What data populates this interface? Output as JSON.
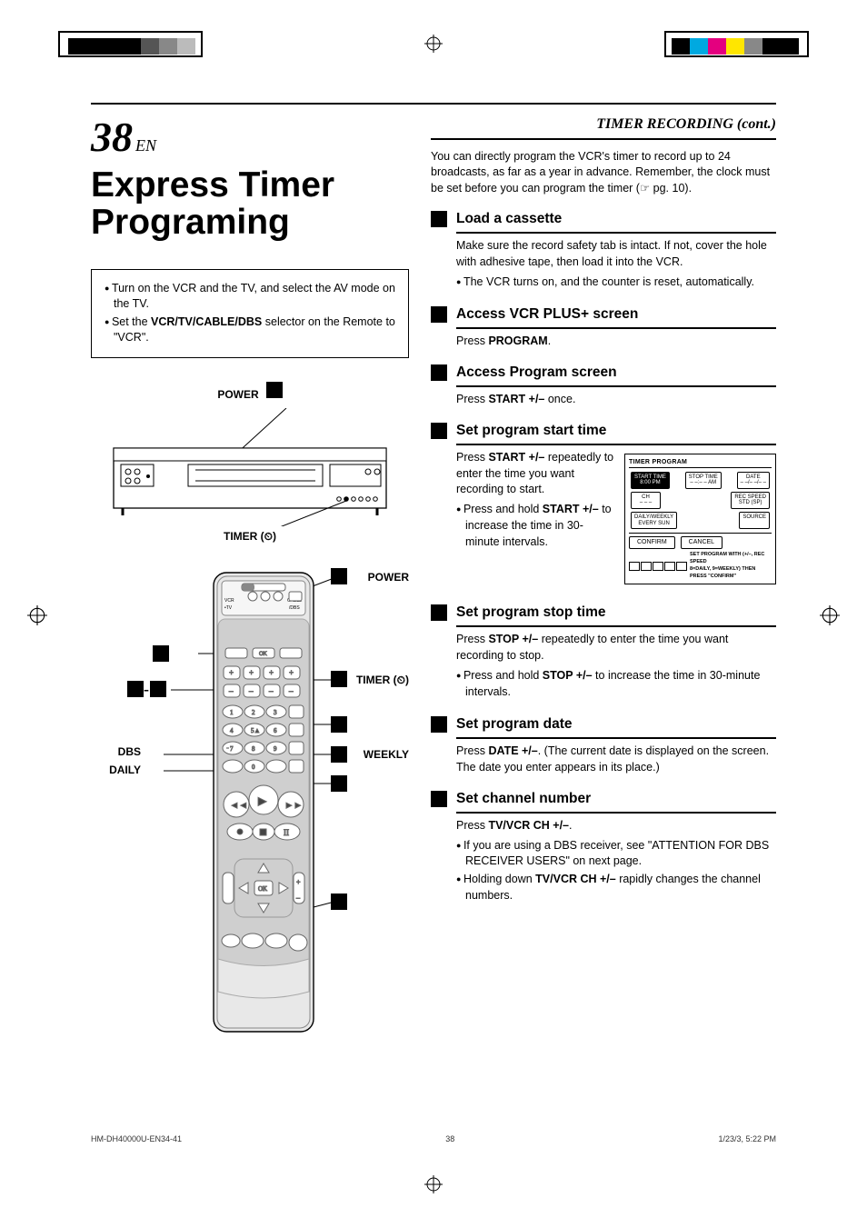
{
  "page": {
    "number": "38",
    "lang_suffix": "EN",
    "running_head": "TIMER RECORDING (cont.)",
    "title": "Express Timer Programing"
  },
  "left_box": {
    "items": [
      "Turn on the VCR and the TV, and select the AV mode on the TV.",
      "Set the <b>VCR/TV/CABLE/DBS</b> selector on the Remote to \"VCR\"."
    ]
  },
  "vcr_labels": {
    "power": "POWER",
    "timer": "TIMER (⏲)"
  },
  "remote_labels": {
    "power": "POWER",
    "timer": "TIMER (⏲)",
    "dbs": "DBS",
    "daily": "DAILY",
    "weekly": "WEEKLY",
    "selector_line1": "VCR",
    "selector_line2": "•TV",
    "selector_line3": "CABLE",
    "selector_line4": "/DBS"
  },
  "intro": "You can directly program the VCR's timer to record up to 24 broadcasts, as far as a year in advance. Remember, the clock must be set before you can program the timer (☞ pg. 10).",
  "steps": [
    {
      "head": "Load a cassette",
      "body": "Make sure the record safety tab is intact. If not, cover the hole with adhesive tape, then load it into the VCR.",
      "bullets": [
        "The VCR turns on, and the counter is reset, automatically."
      ]
    },
    {
      "head": "Access VCR PLUS+ screen",
      "body": "Press <b>PROGRAM</b>."
    },
    {
      "head": "Access Program screen",
      "body": "Press <b>START +/–</b> once."
    },
    {
      "head": "Set program start time",
      "body": "Press <b>START +/–</b> repeatedly to enter the time you want recording to start.",
      "bullets": [
        "Press and hold <b>START +/–</b> to increase the time in 30-minute intervals."
      ]
    },
    {
      "head": "Set program stop time",
      "body": "Press <b>STOP +/–</b> repeatedly to enter the time you want recording to stop.",
      "bullets": [
        "Press and hold <b>STOP +/–</b> to increase the time in 30-minute intervals."
      ]
    },
    {
      "head": "Set program date",
      "body": "Press <b>DATE +/–</b>. (The current date is displayed on the screen. The date you enter appears in its place.)"
    },
    {
      "head": "Set channel number",
      "body": "Press <b>TV/VCR CH +/–</b>.",
      "bullets": [
        "If you are using a DBS receiver, see \"ATTENTION FOR DBS RECEIVER USERS\" on next page.",
        "Holding down <b>TV/VCR CH +/–</b> rapidly changes the channel numbers."
      ]
    }
  ],
  "osd": {
    "title": "TIMER PROGRAM",
    "cells": {
      "start_time": {
        "label": "START TIME",
        "value": "8:00 PM",
        "active": true
      },
      "stop_time": {
        "label": "STOP TIME",
        "value": "– –:– – AM"
      },
      "date": {
        "label": "DATE",
        "value": "– –/– –/– –"
      },
      "ch": {
        "label": "CH",
        "value": "– – –"
      },
      "rec_speed": {
        "label": "REC SPEED",
        "value": "STD (SP)"
      },
      "daily_weekly": {
        "label": "DAILY/WEEKLY",
        "value": "EVERY SUN"
      },
      "source": {
        "label": "SOURCE",
        "value": ""
      }
    },
    "buttons": {
      "confirm": "CONFIRM",
      "cancel": "CANCEL"
    },
    "footnote": "SET PROGRAM WITH (+/–, REC SPEED\n8=DAILY, 9=WEEKLY) THEN PRESS \"CONFIRM\""
  },
  "footer": {
    "file": "HM-DH40000U-EN34-41",
    "page": "38",
    "dt": "1/23/3, 5:22 PM"
  }
}
